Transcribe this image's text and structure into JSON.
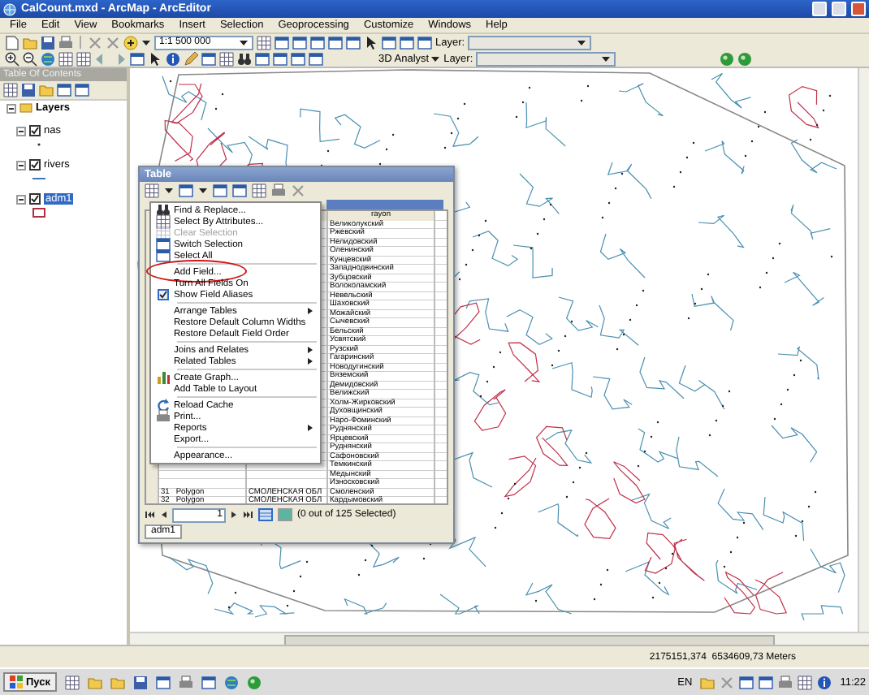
{
  "window": {
    "title": "CalCount.mxd - ArcMap - ArcEditor"
  },
  "menu_bar": [
    "File",
    "Edit",
    "View",
    "Bookmarks",
    "Insert",
    "Selection",
    "Geoprocessing",
    "Customize",
    "Windows",
    "Help"
  ],
  "toolbar": {
    "scale": "1:1 500 000",
    "layer_label": "Layer:",
    "analyst": "3D Analyst",
    "analyst_layer_label": "Layer:"
  },
  "toc": {
    "title": "Table Of Contents",
    "root": {
      "name": "Layers",
      "expanded": true,
      "children": [
        {
          "name": "nas",
          "checked": true,
          "selected": false
        },
        {
          "name": "rivers",
          "checked": true,
          "selected": false
        },
        {
          "name": "adm1",
          "checked": true,
          "selected": true
        }
      ]
    }
  },
  "table_window": {
    "title": "Table",
    "menu": [
      [
        {
          "label": "Find & Replace...",
          "disabled": false,
          "checked": false,
          "submenu": false
        },
        {
          "label": "Select By Attributes...",
          "disabled": false,
          "checked": false,
          "submenu": false
        },
        {
          "label": "Clear Selection",
          "disabled": true,
          "checked": false,
          "submenu": false
        },
        {
          "label": "Switch Selection",
          "disabled": false,
          "checked": false,
          "submenu": false
        },
        {
          "label": "Select All",
          "disabled": false,
          "checked": false,
          "submenu": false
        }
      ],
      [
        {
          "label": "Add Field...",
          "disabled": false,
          "checked": false,
          "submenu": false
        },
        {
          "label": "Turn All Fields On",
          "disabled": false,
          "checked": false,
          "submenu": false
        },
        {
          "label": "Show Field Aliases",
          "disabled": false,
          "checked": true,
          "submenu": false
        }
      ],
      [
        {
          "label": "Arrange Tables",
          "disabled": false,
          "checked": false,
          "submenu": true
        },
        {
          "label": "Restore Default Column Widths",
          "disabled": false,
          "checked": false,
          "submenu": false
        },
        {
          "label": "Restore Default Field Order",
          "disabled": false,
          "checked": false,
          "submenu": false
        }
      ],
      [
        {
          "label": "Joins and Relates",
          "disabled": false,
          "checked": false,
          "submenu": true
        },
        {
          "label": "Related Tables",
          "disabled": false,
          "checked": false,
          "submenu": true
        }
      ],
      [
        {
          "label": "Create Graph...",
          "disabled": false,
          "checked": false,
          "submenu": false
        },
        {
          "label": "Add Table to Layout",
          "disabled": false,
          "checked": false,
          "submenu": false
        }
      ],
      [
        {
          "label": "Reload Cache",
          "disabled": false,
          "checked": false,
          "submenu": false
        },
        {
          "label": "Print...",
          "disabled": false,
          "checked": false,
          "submenu": false
        },
        {
          "label": "Reports",
          "disabled": false,
          "checked": false,
          "submenu": true
        },
        {
          "label": "Export...",
          "disabled": false,
          "checked": false,
          "submenu": false
        }
      ],
      [
        {
          "label": "Appearance...",
          "disabled": false,
          "checked": false,
          "submenu": false
        }
      ]
    ],
    "grid": {
      "header": "rayon",
      "partial_values": [
        "Великолукский",
        "Ржевский",
        "Нелидовский",
        "Оленинский",
        "Кунцевский",
        "Западнодвинский",
        "Зубцовский",
        "Волоколамский",
        "Невельский",
        "Шаховский",
        "Можайский",
        "Сычевский",
        "Бельский",
        "Усвятский",
        "Рузский",
        "Гагаринский",
        "Новодугинский",
        "Вяземский",
        "Демидовский",
        "Велижский",
        "Холм-Жирковский",
        "Духовщинский",
        "Наро-Фоминский",
        "Руднянский",
        "Ярцевский",
        "Руднянский",
        "Сафоновский",
        "Темкинский",
        "Медынский",
        "Износковский"
      ],
      "full_rows": [
        {
          "fid": "31",
          "shape": "Polygon",
          "region": "СМОЛЕНСКАЯ ОБЛ",
          "rayon": "Смоленский"
        },
        {
          "fid": "32",
          "shape": "Polygon",
          "region": "СМОЛЕНСКАЯ ОБЛ",
          "rayon": "Кардымовский"
        }
      ]
    },
    "record_nav": {
      "current": "1",
      "selection": "(0 out of 125 Selected)"
    },
    "tab": "adm1"
  },
  "status_bar": {
    "coordinates": "2175151,374  6534609,73 Meters"
  },
  "taskbar": {
    "start": "Пуск",
    "language": "EN",
    "clock": "11:22"
  }
}
